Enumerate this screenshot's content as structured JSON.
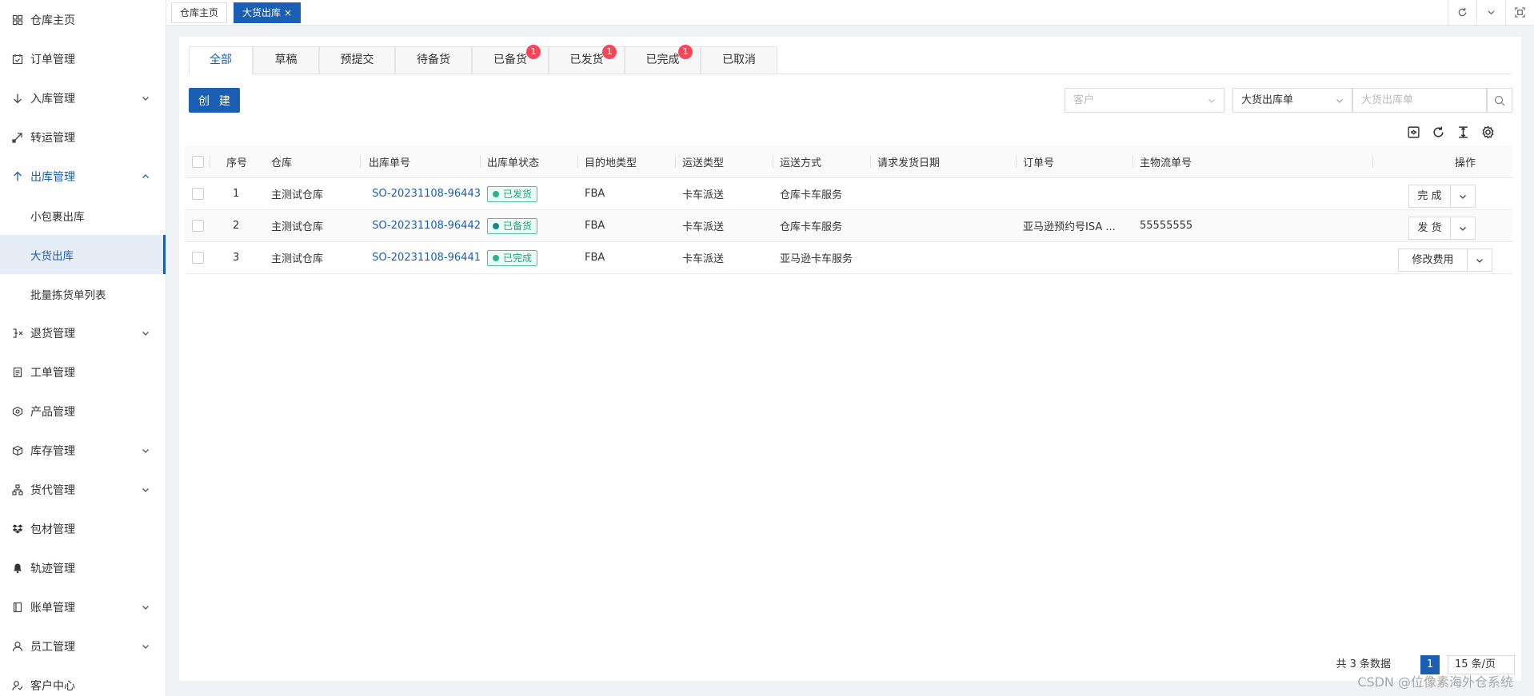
{
  "sidebar": {
    "items": [
      {
        "label": "仓库主页",
        "icon": "grid-icon",
        "expandable": false
      },
      {
        "label": "订单管理",
        "icon": "calendar-check-icon",
        "expandable": false
      },
      {
        "label": "入库管理",
        "icon": "arrow-down-icon",
        "expandable": true
      },
      {
        "label": "转运管理",
        "icon": "transfer-icon",
        "expandable": false
      },
      {
        "label": "出库管理",
        "icon": "arrow-up-icon",
        "expandable": true,
        "open": true
      },
      {
        "label": "小包裹出库",
        "sub": true
      },
      {
        "label": "大货出库",
        "sub": true,
        "active": true
      },
      {
        "label": "批量拣货单列表",
        "sub": true
      },
      {
        "label": "退货管理",
        "icon": "return-icon",
        "expandable": true
      },
      {
        "label": "工单管理",
        "icon": "document-icon",
        "expandable": false
      },
      {
        "label": "产品管理",
        "icon": "product-icon",
        "expandable": false
      },
      {
        "label": "库存管理",
        "icon": "box-icon",
        "expandable": true
      },
      {
        "label": "货代管理",
        "icon": "org-icon",
        "expandable": true
      },
      {
        "label": "包材管理",
        "icon": "package-icon",
        "expandable": false
      },
      {
        "label": "轨迹管理",
        "icon": "bell-icon",
        "expandable": false
      },
      {
        "label": "账单管理",
        "icon": "bill-icon",
        "expandable": true
      },
      {
        "label": "员工管理",
        "icon": "user-icon",
        "expandable": true
      },
      {
        "label": "客户中心",
        "icon": "customer-icon",
        "expandable": false
      }
    ]
  },
  "page_tabs": [
    {
      "label": "仓库主页",
      "active": false
    },
    {
      "label": "大货出库",
      "active": true,
      "close": "×"
    }
  ],
  "status_tabs": [
    {
      "label": "全部",
      "active": true,
      "badge": ""
    },
    {
      "label": "草稿",
      "badge": ""
    },
    {
      "label": "预提交",
      "badge": ""
    },
    {
      "label": "待备货",
      "badge": ""
    },
    {
      "label": "已备货",
      "badge": "1"
    },
    {
      "label": "已发货",
      "badge": "1"
    },
    {
      "label": "已完成",
      "badge": "1"
    },
    {
      "label": "已取消",
      "badge": ""
    }
  ],
  "toolbar": {
    "create_label": "创 建",
    "customer_placeholder": "客户",
    "type_select": "大货出库单",
    "search_placeholder": "大货出库单"
  },
  "table": {
    "headers": [
      "序号",
      "仓库",
      "出库单号",
      "出库单状态",
      "目的地类型",
      "运送类型",
      "运送方式",
      "请求发货日期",
      "订单号",
      "主物流单号",
      "操作"
    ],
    "rows": [
      {
        "index": "1",
        "warehouse": "主测试仓库",
        "order_no": "SO-20231108-96443",
        "status": "已发货",
        "status_dot": "#2bb487",
        "dest_type": "FBA",
        "ship_type": "卡车派送",
        "ship_method": "仓库卡车服务",
        "req_date": "",
        "order_ref": "",
        "tracking": "",
        "action": "完 成"
      },
      {
        "index": "2",
        "warehouse": "主测试仓库",
        "order_no": "SO-20231108-96442",
        "status": "已备货",
        "status_dot": "#138a8a",
        "dest_type": "FBA",
        "ship_type": "卡车派送",
        "ship_method": "仓库卡车服务",
        "req_date": "",
        "order_ref": "亚马逊预约号ISA ...",
        "tracking": "55555555",
        "action": "发 货"
      },
      {
        "index": "3",
        "warehouse": "主测试仓库",
        "order_no": "SO-20231108-96441",
        "status": "已完成",
        "status_dot": "#2bb487",
        "dest_type": "FBA",
        "ship_type": "卡车派送",
        "ship_method": "亚马逊卡车服务",
        "req_date": "",
        "order_ref": "",
        "tracking": "",
        "action": "修改费用"
      }
    ]
  },
  "pagination": {
    "total": "共 3 条数据",
    "page": "1",
    "page_size": "15 条/页"
  },
  "watermark": "CSDN @位像素海外仓系统",
  "colors": {
    "primary": "#1a5fb4",
    "badge": "#f5465a",
    "status_green": "#2aa37f"
  }
}
